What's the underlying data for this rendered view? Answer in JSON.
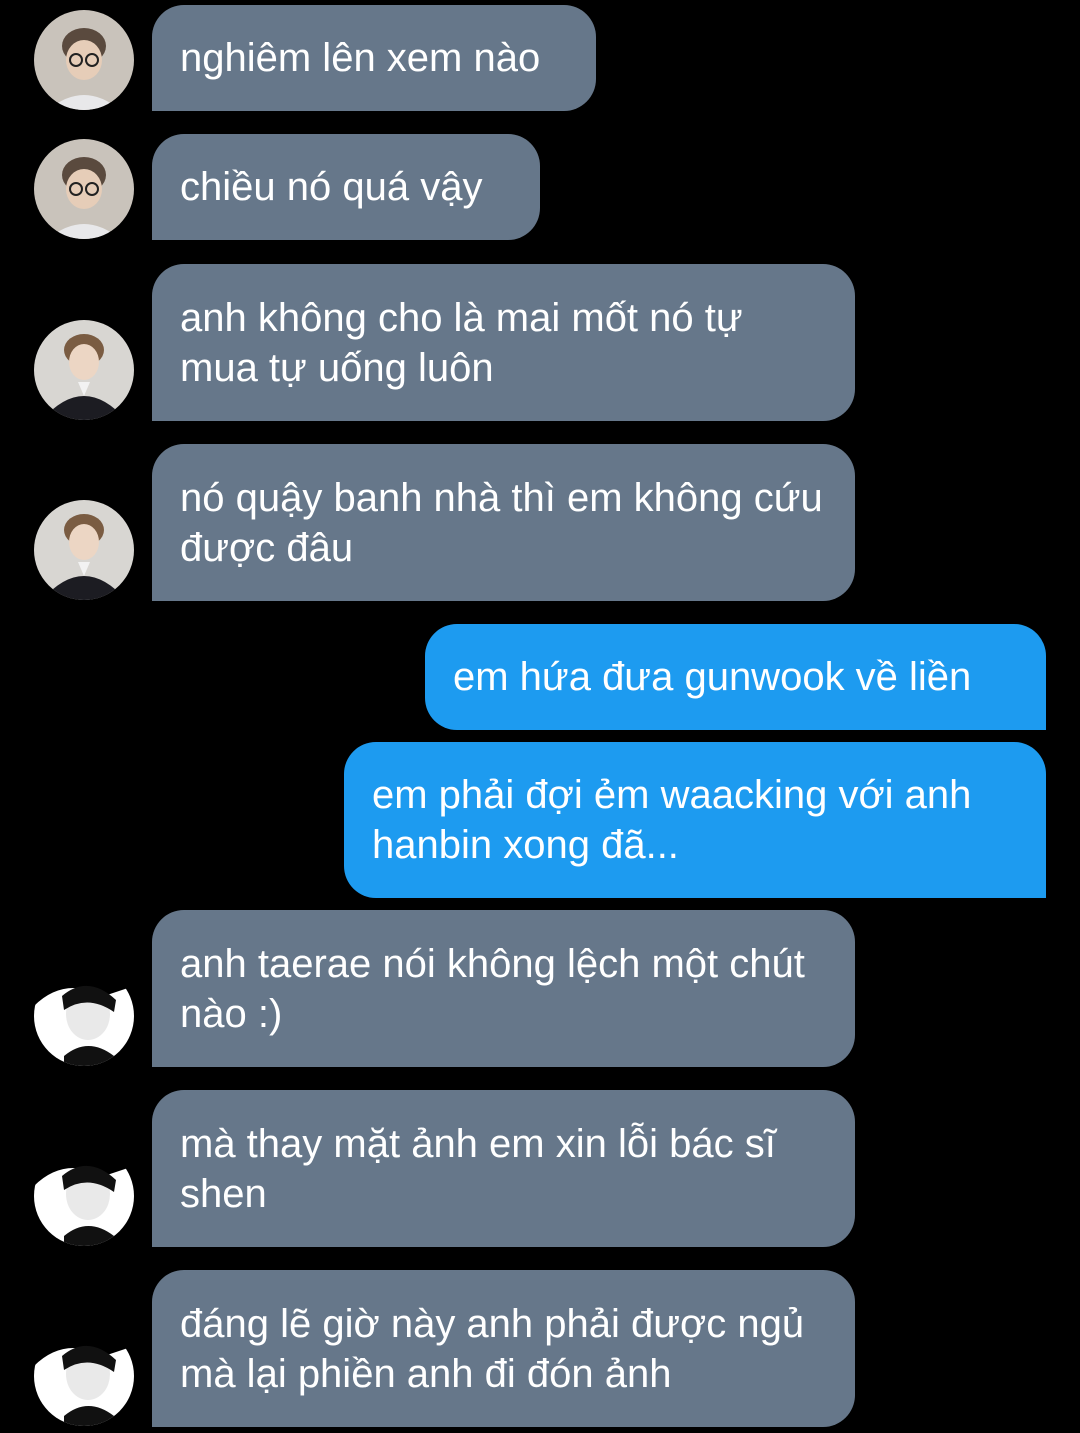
{
  "colors": {
    "background": "#000000",
    "incoming_bubble": "#66778a",
    "outgoing_bubble": "#1d9bf0",
    "text": "#ffffff"
  },
  "messages": [
    {
      "direction": "incoming",
      "avatar": "avatar-glasses",
      "text": "nghiêm lên xem nào"
    },
    {
      "direction": "incoming",
      "avatar": "avatar-glasses",
      "text": "chiều nó quá vậy"
    },
    {
      "direction": "incoming",
      "avatar": "avatar-suit",
      "text": "anh không cho là mai mốt nó tự mua tự uống luôn"
    },
    {
      "direction": "incoming",
      "avatar": "avatar-suit",
      "text": "nó quậy banh nhà thì em không cứu được đâu"
    },
    {
      "direction": "outgoing",
      "text": "em hứa đưa gunwook về liền"
    },
    {
      "direction": "outgoing",
      "text": "em phải đợi ẻm waacking với anh hanbin xong đã..."
    },
    {
      "direction": "incoming",
      "avatar": "avatar-monochrome",
      "text": "anh taerae nói không lệch một chút nào :)"
    },
    {
      "direction": "incoming",
      "avatar": "avatar-monochrome",
      "text": "mà thay mặt ảnh em xin lỗi bác sĩ shen"
    },
    {
      "direction": "incoming",
      "avatar": "avatar-monochrome",
      "text": "đáng lẽ giờ này anh phải được ngủ mà lại phiền anh đi đón ảnh"
    }
  ]
}
